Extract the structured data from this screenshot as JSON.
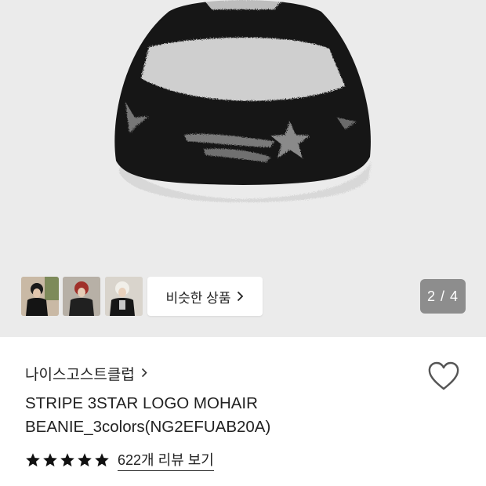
{
  "gallery": {
    "similar_button_label": "비슷한 상품",
    "pager": "2 / 4",
    "thumbnails": [
      "model-photo-1",
      "model-photo-2",
      "model-photo-3"
    ]
  },
  "product": {
    "brand": "나이스고스트클럽",
    "title_line1": "STRIPE 3STAR LOGO MOHAIR",
    "title_line2": "BEANIE_3colors(NG2EFUAB20A)",
    "rating_stars": 5,
    "review_link": "622개 리뷰 보기"
  },
  "colors": {
    "hero_bg": "#ebebeb",
    "beanie_dark": "#151515",
    "beanie_light": "#d4d4d4",
    "star": "#111111",
    "heart_stroke": "#555555",
    "pager_bg": "#6e6e6e"
  },
  "icons": {
    "heart": "heart-outline-icon",
    "brand_chevron": "chevron-right-icon",
    "button_chevron": "chevron-right-icon",
    "star": "star-filled-icon"
  }
}
